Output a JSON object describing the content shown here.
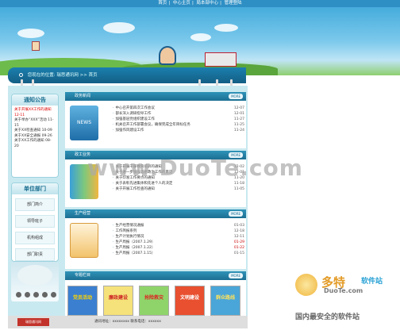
{
  "top_nav": {
    "links": [
      "首页",
      "中心主页",
      "局本部中心",
      "管理登陆"
    ]
  },
  "nav_bar": {
    "text": "您现在的位置: 瑞思通讯网 >> 首页"
  },
  "left": {
    "notice_title": "通知公告",
    "notice_items": [
      {
        "text": "关于开展XX工作的通知",
        "date": "12-11"
      },
      {
        "text": "关于举办“XXX”活动",
        "date": "11-15"
      },
      {
        "text": "关于XX检查通知",
        "date": "10-09"
      },
      {
        "text": "关于XX安全通报",
        "date": "09-26"
      },
      {
        "text": "关于XX工作的通知",
        "date": "08-20"
      }
    ],
    "dept_title": "单位部门",
    "dept_items": [
      "部门简介",
      "领导班子",
      "机构组成",
      "部门职责"
    ]
  },
  "sections": [
    {
      "title": "政务新闻",
      "more": "MORE",
      "icon_label": "NEWS",
      "rows": [
        {
          "text": "中心召开第四次工作会议",
          "date": "12-07"
        },
        {
          "text": "部长深入调研指导工作",
          "date": "12-01"
        },
        {
          "text": "加强基层党组织建设工作",
          "date": "11-27"
        },
        {
          "text": "机关召开工作部署会议，确保完成全年目标任务",
          "date": "11-25"
        },
        {
          "text": "加强作风建设工作",
          "date": "11-24"
        }
      ]
    },
    {
      "title": "政工业务",
      "more": "MORE",
      "icon_label": "",
      "rows": [
        {
          "text": "关于开展干部教育培训的通知",
          "date": "12-02"
        },
        {
          "text": "关于进一步加强思想政治工作的意见",
          "date": "12-01"
        },
        {
          "text": "关于印发工作要点的通知",
          "date": "11-20"
        },
        {
          "text": "关于表彰先进集体和先进个人的决定",
          "date": "11-18"
        },
        {
          "text": "关于开展工作检查的通知",
          "date": "11-05"
        }
      ]
    },
    {
      "title": "生产经营",
      "more": "MORE",
      "icon_label": "",
      "rows": [
        {
          "text": "生产经营情况通报",
          "date": "01-03"
        },
        {
          "text": "工作简报系列",
          "date": "12-18"
        },
        {
          "text": "生产计划执行情况",
          "date": "12-11"
        },
        {
          "text": "生产周报（2007.1.29）",
          "date": "01-29",
          "red": true
        },
        {
          "text": "生产周报（2007.1.22）",
          "date": "01-22",
          "red": true
        },
        {
          "text": "生产周报（2007.1.15）",
          "date": "01-15"
        }
      ]
    }
  ],
  "special_title": "专题栏目",
  "special_more": "MORE",
  "thumbs": [
    "党员活动",
    "廉政建设",
    "抢险救灾",
    "文明建设",
    "群众路线"
  ],
  "footer": {
    "logo": "瑞思通讯网",
    "text": "通讯地址：xxxxxxxx  联系电话：xxxxxx"
  },
  "watermark": {
    "main": "www.DuoTe.com",
    "brand": "多特",
    "brand2": "软件站",
    "url": "DuoTe.com",
    "bottom": "国内最安全的软件站"
  },
  "colors": {
    "primary": "#1c6f93",
    "frame": "#c9e9f0",
    "accent": "#c2332b"
  }
}
